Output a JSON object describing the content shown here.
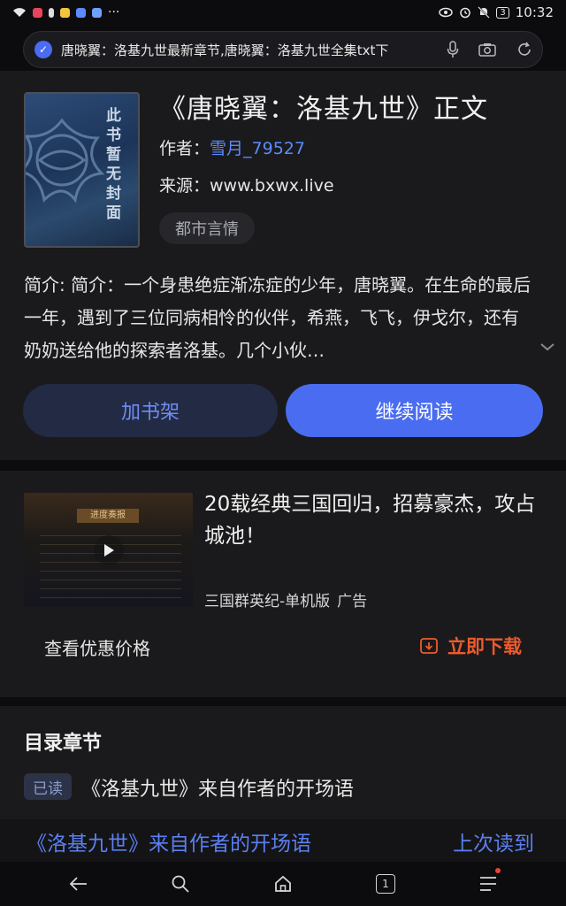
{
  "status_bar": {
    "time": "10:32",
    "battery": "3"
  },
  "address_bar": {
    "url_title": "唐晓翼：洛基九世最新章节,唐晓翼：洛基九世全集txt下"
  },
  "book": {
    "cover_text": "此书暂无封面",
    "title": "《唐晓翼：洛基九世》正文",
    "author_label": "作者：",
    "author_name": "雪月_79527",
    "source_label": "来源：",
    "source_value": "www.bxwx.live",
    "genre_tag": "都市言情",
    "intro": "简介: 简介：一个身患绝症渐冻症的少年，唐晓翼。在生命的最后一年，遇到了三位同病相怜的伙伴，希燕，飞飞，伊戈尔，还有奶奶送给他的探索者洛基。几个小伙…",
    "add_shelf_label": "加书架",
    "continue_read_label": "继续阅读"
  },
  "ad": {
    "video_caption": "进度奏报",
    "title": "20载经典三国回归，招募豪杰，攻占城池！",
    "source": "三国群英纪-单机版",
    "ad_label": "广告",
    "view_price_label": "查看优惠价格",
    "download_label": "立即下载"
  },
  "toc": {
    "heading": "目录章节",
    "read_badge": "已读",
    "chapter_1": "《洛基九世》来自作者的开场语",
    "last_read_chapter": "《洛基九世》来自作者的开场语",
    "last_read_label": "上次读到"
  },
  "bottom_nav": {
    "tab_count": "1"
  },
  "colors": {
    "accent": "#4a6cf0",
    "link": "#5b8cff",
    "download": "#ec5b2c"
  }
}
